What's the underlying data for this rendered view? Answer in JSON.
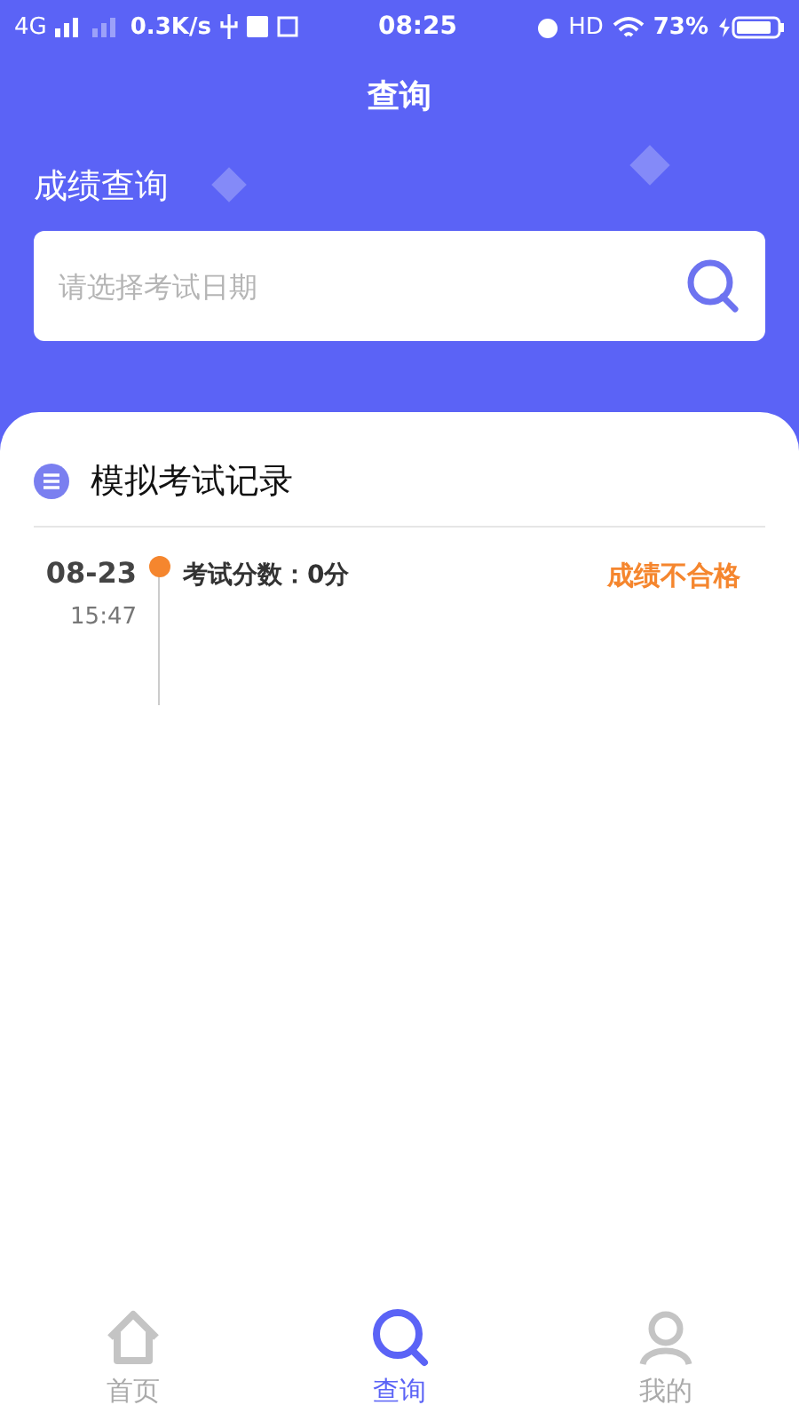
{
  "status_bar": {
    "network": "4G",
    "speed": "0.3K/s",
    "time": "08:25",
    "hd": "HD",
    "battery": "73%"
  },
  "header": {
    "title": "查询",
    "section": "成绩查询",
    "search": {
      "placeholder": "请选择考试日期"
    }
  },
  "records": {
    "title": "模拟考试记录",
    "items": [
      {
        "date": "08-23",
        "time": "15:47",
        "score": "考试分数：0分",
        "result": "成绩不合格",
        "color": "#f5862e"
      }
    ]
  },
  "tabs": [
    {
      "label": "首页",
      "kind": "home",
      "selected": false
    },
    {
      "label": "查询",
      "kind": "search",
      "selected": true
    },
    {
      "label": "我的",
      "kind": "profile",
      "selected": false
    }
  ]
}
